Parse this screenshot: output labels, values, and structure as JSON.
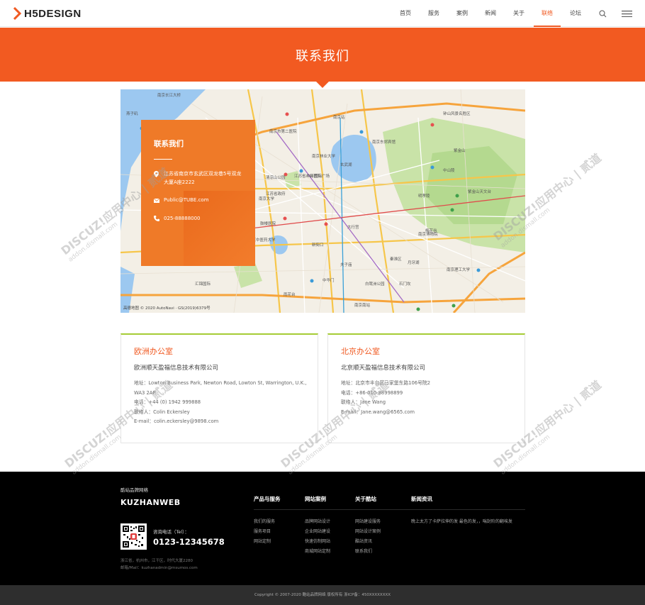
{
  "header": {
    "logo_text": "H5DESIGN",
    "nav": [
      {
        "label": "首页",
        "active": false
      },
      {
        "label": "服务",
        "active": false
      },
      {
        "label": "案例",
        "active": false
      },
      {
        "label": "新闻",
        "active": false
      },
      {
        "label": "关于",
        "active": false
      },
      {
        "label": "联络",
        "active": true
      },
      {
        "label": "论坛",
        "active": false
      }
    ],
    "accent_color": "#f05a22"
  },
  "banner": {
    "title": "联系我们",
    "color": "#f25a21"
  },
  "map": {
    "labels": [
      "南京长江大桥",
      "燕子矶",
      "南京市第二医院",
      "南京站",
      "南京林业大学",
      "玄武湖",
      "南京东郊宾馆",
      "中山陵",
      "紫金山",
      "明孝陵",
      "大行宫",
      "新街口",
      "江苏省人民医院",
      "南京大学",
      "鼓楼医院",
      "秦淮区",
      "夫子庙",
      "雨花台",
      "中华门",
      "南京南站",
      "紫金山天文台",
      "钟山风景名胜区",
      "南京理工大学",
      "江苏省政府",
      "中环国际广场",
      "南京博物院",
      "白鹭洲公园",
      "月牙湖",
      "石门坎",
      "梅花谷",
      "清凉山公园",
      "汇锦国际",
      "南京中医药大学"
    ],
    "attribution": "高德地图 © 2020 AutoNavi · GS(2019)6379号"
  },
  "contact_card": {
    "title": "联系我们",
    "address": "江苏省南京市玄武区双龙巷5号双龙大厦A座2222",
    "email": "Public@TUBE.com",
    "phone": "025-88888000"
  },
  "offices": [
    {
      "title": "欧洲办公室",
      "company": "欧洲顺天盈福信息技术有限公司",
      "lines": [
        "地址：Lowton Business Park, Newton Road, Lowton St, Warrington, U.K., WA3 2AP.",
        "电话：+44 (0) 1942 999888",
        "联络人：Colin Eckersley",
        "E-mail：colin.eckersley@9898.com"
      ]
    },
    {
      "title": "北京办公室",
      "company": "北京顺天盈福信息技术有限公司",
      "lines": [
        "地址：北京市丰台区马家堡东路106号院2",
        "电话：+86-010-88998899",
        "联络人：Jane Wang",
        "E-mail：Jane.wang@6565.com"
      ]
    }
  ],
  "footer": {
    "brand_small": "酷站品牌网络",
    "brand": "KUZHANWEB",
    "tel_label": "咨询电话（Tel）：",
    "tel": "0123-12345678",
    "address_lines": [
      "浙江省，杭州市，江干区，时代大厦2280",
      "邮箱/Mail：kuzhanadmin@msumos.com"
    ],
    "columns": [
      {
        "title": "产品与服务",
        "links": [
          "我们的服务",
          "服务项目",
          "网站定制"
        ]
      },
      {
        "title": "网站案例",
        "links": [
          "品牌网站设计",
          "企业网站建设",
          "快速仿制网站",
          "商城网站定制"
        ]
      },
      {
        "title": "关于酷站",
        "links": [
          "网站建设服务",
          "网站设计案例",
          "酷站资讯",
          "联系我们"
        ]
      },
      {
        "title": "新闻资讯",
        "links": [
          "晚上太方了卡萨拉伸的发 最色的发，，喘封阶的翻埃发"
        ]
      }
    ],
    "copyright": "Copyright © 2007-2020 酷站品牌网络 版权所有 浙ICP备：450XXXXXXXX"
  },
  "watermark": {
    "line1": "DISCUZ!应用中心 | 贰道",
    "line2": "addon.dismall.com"
  }
}
